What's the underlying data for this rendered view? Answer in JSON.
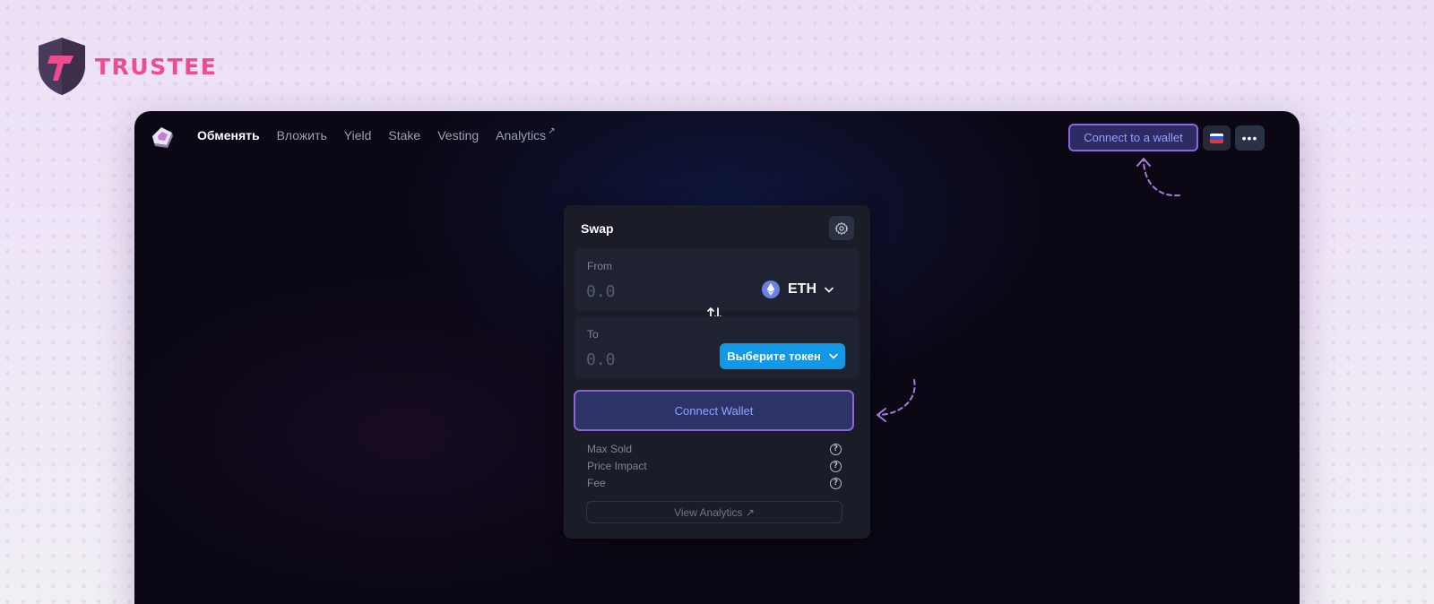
{
  "brand": {
    "name": "TRUSTEE",
    "color": "#ef4b91"
  },
  "nav": {
    "items": [
      {
        "label": "Обменять",
        "active": true
      },
      {
        "label": "Вложить"
      },
      {
        "label": "Yield"
      },
      {
        "label": "Stake"
      },
      {
        "label": "Vesting"
      },
      {
        "label": "Analytics",
        "external": true
      }
    ],
    "ext_arrow": "↗",
    "connect_label": "Connect to a wallet",
    "more_label": "•••",
    "language_icon": "russia-flag-icon"
  },
  "swap": {
    "title": "Swap",
    "from": {
      "label": "From",
      "amount_placeholder": "0.0",
      "token": "ETH"
    },
    "to": {
      "label": "To",
      "amount_placeholder": "0.0",
      "choose_label": "Выберите токен"
    },
    "connect_label": "Connect Wallet",
    "info": [
      {
        "label": "Max Sold"
      },
      {
        "label": "Price Impact"
      },
      {
        "label": "Fee"
      }
    ],
    "help_glyph": "?",
    "view_analytics_label": "View Analytics ↗"
  },
  "colors": {
    "accent_purple": "#8a67e0",
    "accent_blue": "#1398e8",
    "app_background": "#0b0714"
  }
}
